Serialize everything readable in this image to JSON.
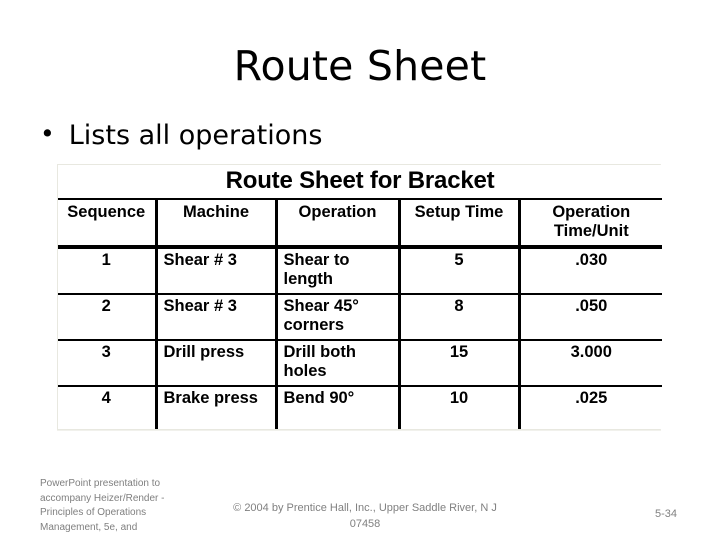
{
  "slide": {
    "title": "Route Sheet",
    "bullet_marker": "•",
    "bullets": [
      {
        "text": "Lists all operations"
      }
    ]
  },
  "figure": {
    "title": "Route Sheet for Bracket",
    "columns": [
      {
        "label": "Sequence",
        "align": "center"
      },
      {
        "label": "Machine",
        "align": "left"
      },
      {
        "label": "Operation",
        "align": "left"
      },
      {
        "label": "Setup Time",
        "align": "center"
      },
      {
        "label": "Operation Time/Unit",
        "align": "center"
      }
    ],
    "rows": [
      {
        "sequence": "1",
        "machine": "Shear # 3",
        "operation": "Shear to length",
        "setup_time": "5",
        "operation_time_per_unit": ".030"
      },
      {
        "sequence": "2",
        "machine": "Shear # 3",
        "operation": "Shear 45° corners",
        "setup_time": "8",
        "operation_time_per_unit": ".050"
      },
      {
        "sequence": "3",
        "machine": "Drill press",
        "operation": "Drill both holes",
        "setup_time": "15",
        "operation_time_per_unit": "3.000"
      },
      {
        "sequence": "4",
        "machine": "Brake press",
        "operation": "Bend 90°",
        "setup_time": "10",
        "operation_time_per_unit": ".025"
      }
    ]
  },
  "footer": {
    "credit": "PowerPoint presentation to accompany Heizer/Render - Principles of Operations Management, 5e, and",
    "copyright": "© 2004 by Prentice Hall, Inc., Upper Saddle River, N J 07458",
    "page_number": "5-34"
  },
  "colors": {
    "text": "#000000",
    "footer_text": "#808080",
    "background": "#ffffff",
    "table_rule": "#000000"
  }
}
